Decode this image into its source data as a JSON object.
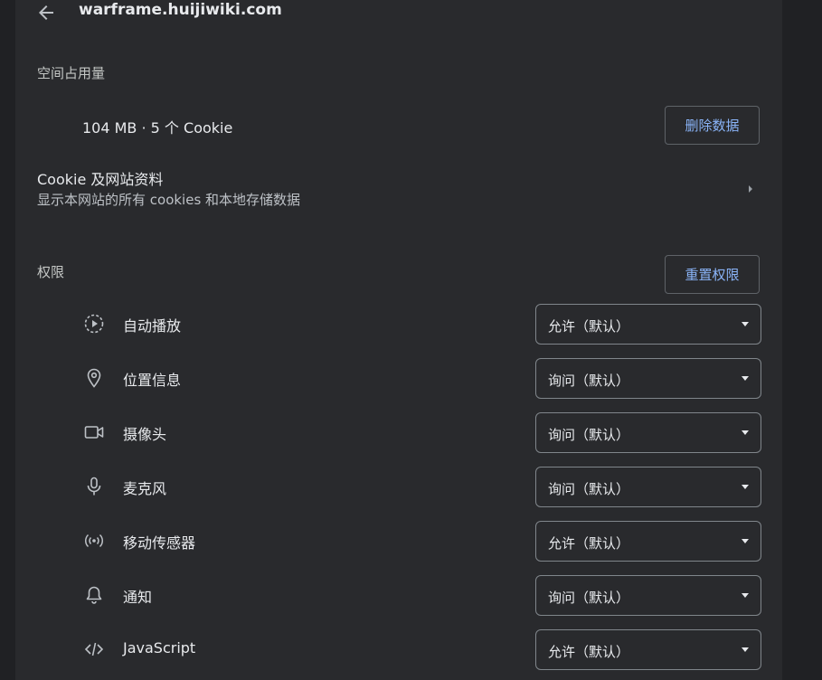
{
  "header": {
    "title": "warframe.huijiwiki.com",
    "back_icon": "arrow-back-icon"
  },
  "usage": {
    "section_label": "空间占用量",
    "summary": "104 MB · 5 个 Cookie",
    "delete_button": "删除数据"
  },
  "cookies": {
    "title": "Cookie 及网站资料",
    "subtitle": "显示本网站的所有 cookies 和本地存储数据"
  },
  "permissions": {
    "section_label": "权限",
    "reset_button": "重置权限",
    "items": [
      {
        "label": "自动播放",
        "value": "允许（默认）",
        "icon": "autoplay-icon"
      },
      {
        "label": "位置信息",
        "value": "询问（默认）",
        "icon": "location-icon"
      },
      {
        "label": "摄像头",
        "value": "询问（默认）",
        "icon": "camera-icon"
      },
      {
        "label": "麦克风",
        "value": "询问（默认）",
        "icon": "microphone-icon"
      },
      {
        "label": "移动传感器",
        "value": "允许（默认）",
        "icon": "motion-sensor-icon"
      },
      {
        "label": "通知",
        "value": "询问（默认）",
        "icon": "bell-icon"
      },
      {
        "label": "JavaScript",
        "value": "允许（默认）",
        "icon": "code-icon"
      }
    ]
  },
  "colors": {
    "page_bg": "#202124",
    "panel_bg": "#292a2d",
    "accent": "#8ab4f8",
    "border": "#5f6368"
  }
}
